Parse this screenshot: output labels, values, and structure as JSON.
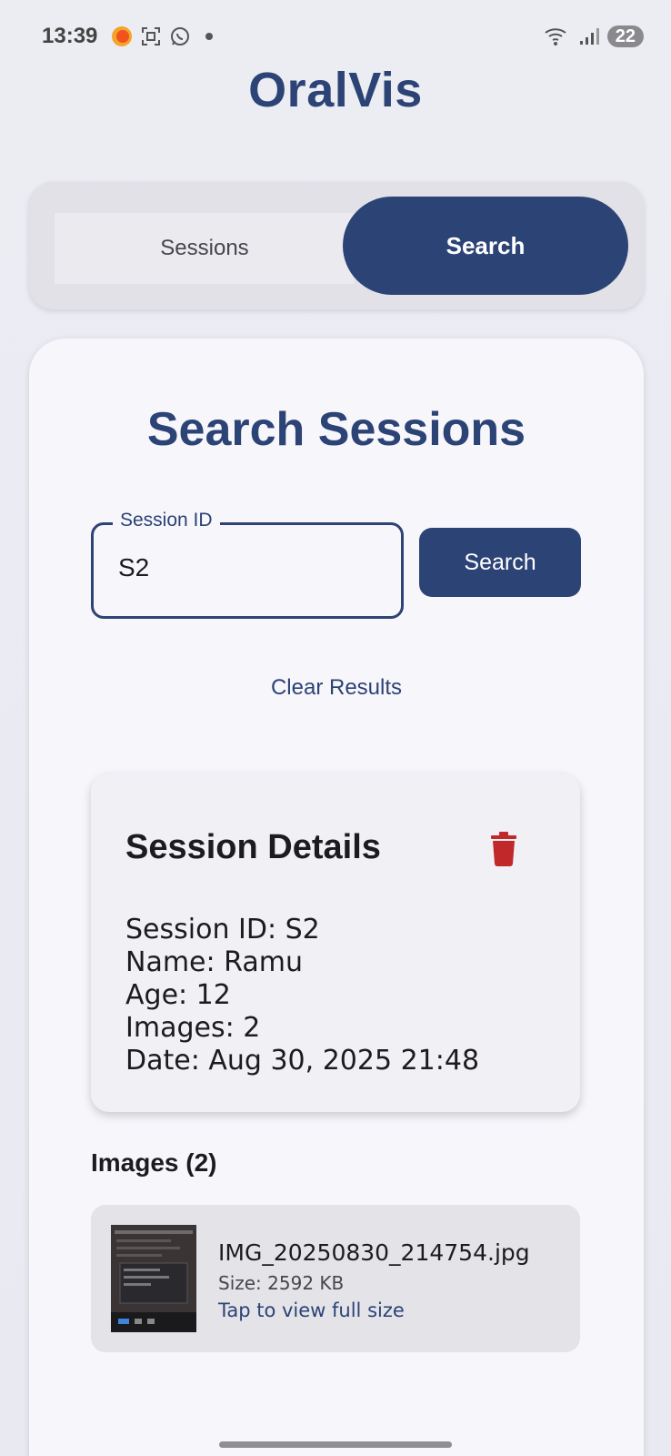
{
  "status_bar": {
    "time": "13:39",
    "battery": "22",
    "left_icons": [
      "notification-orange-icon",
      "screenshot-icon",
      "whatsapp-icon",
      "dot-icon"
    ],
    "right_icons": [
      "wifi-icon",
      "signal-icon",
      "battery-icon"
    ]
  },
  "app": {
    "title": "OralVis"
  },
  "tabs": [
    {
      "label": "Sessions",
      "selected": false
    },
    {
      "label": "Search",
      "selected": true
    }
  ],
  "search": {
    "heading": "Search Sessions",
    "field_label": "Session ID",
    "field_value": "S2",
    "button_label": "Search",
    "clear_label": "Clear Results"
  },
  "details": {
    "title": "Session Details",
    "lines": [
      "Session ID: S2",
      "Name: Ramu",
      "Age: 12",
      "Images: 2",
      "Date: Aug 30, 2025 21:48"
    ]
  },
  "images": {
    "heading": "Images (2)",
    "items": [
      {
        "file_name": "IMG_20250830_214754.jpg",
        "size": "Size: 2592 KB",
        "action": "Tap to view full size"
      }
    ]
  },
  "colors": {
    "primary": "#2c4375",
    "background": "#ececf3",
    "card": "#f7f6fb",
    "delete": "#c0282a"
  }
}
